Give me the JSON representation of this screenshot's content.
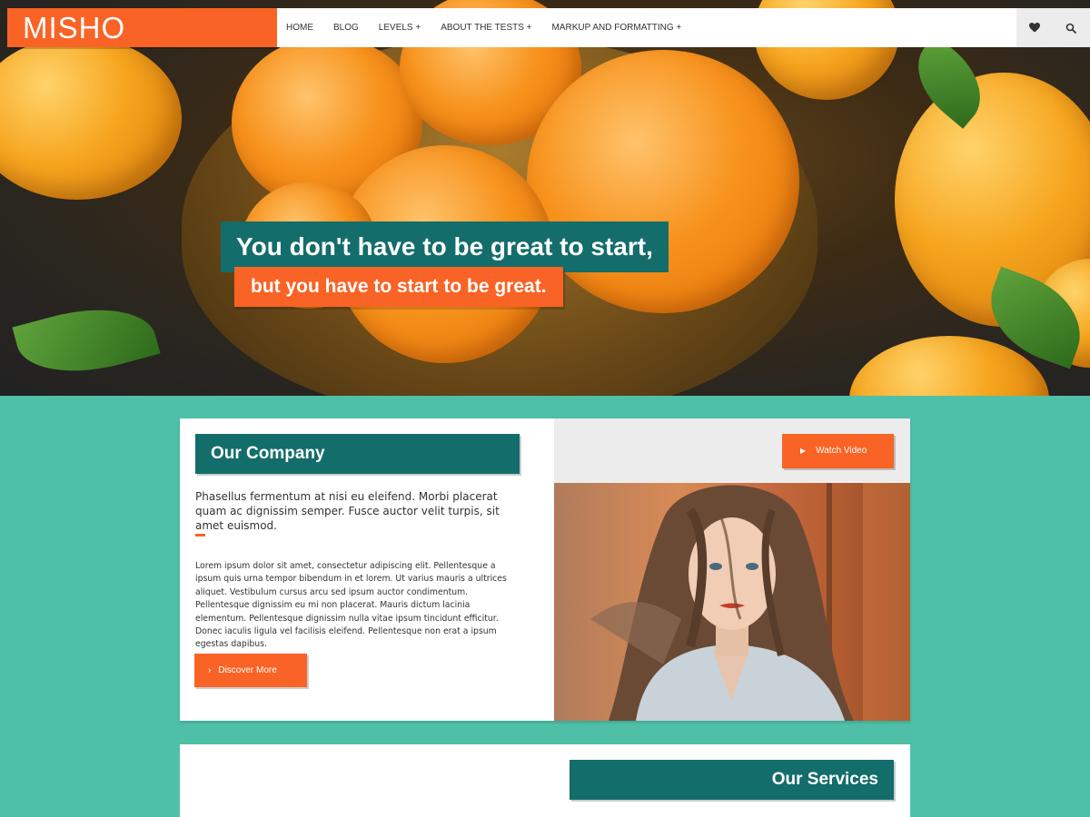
{
  "brand": {
    "logo_text": "MISHO",
    "primary_color": "#f96325",
    "secondary_color": "#136d6b",
    "background_color": "#4fc0a8"
  },
  "nav": {
    "items": [
      {
        "label": "HOME"
      },
      {
        "label": "BLOG"
      },
      {
        "label": "LEVELS +"
      },
      {
        "label": "ABOUT THE TESTS +"
      },
      {
        "label": "MARKUP AND FORMATTING +"
      }
    ],
    "icons": [
      "heart-icon",
      "search-icon"
    ]
  },
  "hero": {
    "line1": "You don't have to be great to start,",
    "line2": "but you have to start to be great."
  },
  "company": {
    "heading": "Our Company",
    "lead": "Phasellus fermentum at nisi eu eleifend. Morbi placerat quam ac dignissim semper. Fusce auctor velit turpis, sit amet euismod.",
    "body": "Lorem ipsum dolor sit amet, consectetur adipiscing elit. Pellentesque a ipsum quis urna tempor bibendum in et lorem. Ut varius mauris a ultrices aliquet. Vestibulum cursus arcu sed ipsum auctor condimentum. Pellentesque dignissim eu mi non placerat. Mauris dictum lacinia elementum. Pellentesque dignissim nulla vitae ipsum tincidunt efficitur. Donec iaculis ligula vel facilisis eleifend. Pellentesque non erat a ipsum egestas dapibus.",
    "discover_label": "Discover More",
    "watch_label": "Watch Video"
  },
  "services": {
    "heading": "Our Services"
  }
}
